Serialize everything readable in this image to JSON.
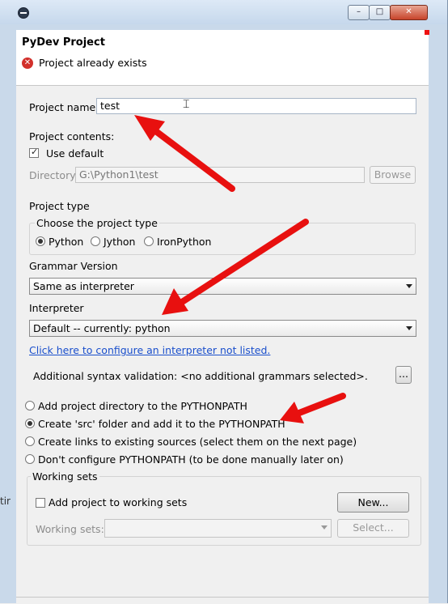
{
  "window": {
    "min_label": "–",
    "max_label": "□",
    "close_label": "✕"
  },
  "header": {
    "title": "PyDev Project",
    "message": "Project already exists"
  },
  "project_name": {
    "label": "Project name:",
    "value": "test"
  },
  "contents": {
    "label": "Project contents:",
    "use_default_label": "Use default",
    "use_default_checked": true,
    "directory_label": "Directory",
    "directory_value": "G:\\Python1\\test",
    "browse_label": "Browse"
  },
  "project_type": {
    "label": "Project type",
    "group_label": "Choose the project type",
    "options": [
      "Python",
      "Jython",
      "IronPython"
    ],
    "selected": "Python"
  },
  "grammar": {
    "label": "Grammar Version",
    "value": "Same as interpreter"
  },
  "interpreter": {
    "label": "Interpreter",
    "value": "Default  --  currently: python",
    "config_link": "Click here to configure an interpreter not listed."
  },
  "syntax": {
    "text": "Additional syntax validation: <no additional grammars selected>.",
    "button_label": "..."
  },
  "pythonpath": {
    "options": [
      "Add project directory to the PYTHONPATH",
      "Create 'src' folder and add it to the PYTHONPATH",
      "Create links to existing sources (select them on the next page)",
      "Don't configure PYTHONPATH (to be done manually later on)"
    ],
    "selected_index": 1
  },
  "working_sets": {
    "group_label": "Working sets",
    "add_label": "Add project to working sets",
    "add_checked": false,
    "new_label": "New...",
    "sets_label": "Working sets:",
    "select_label": "Select..."
  },
  "background": {
    "side_text": "tir"
  },
  "colors": {
    "annotation_arrow": "#e8100f",
    "link": "#1a4fcc",
    "error": "#d2302b"
  }
}
